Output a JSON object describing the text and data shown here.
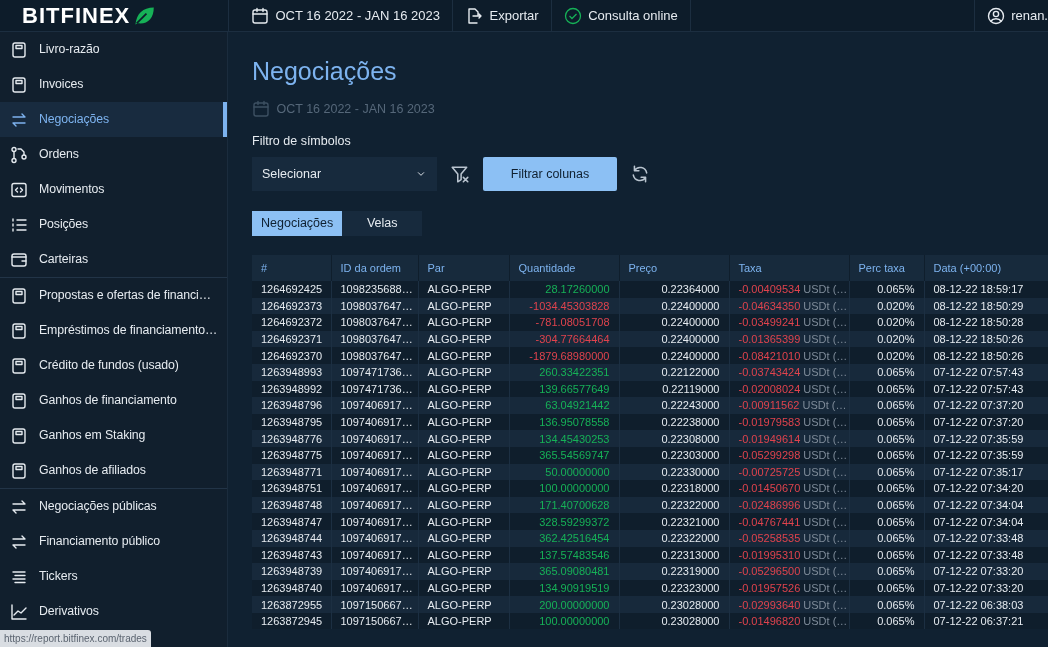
{
  "topbar": {
    "logo": "BITFINEX",
    "date_range": "OCT 16 2022 - JAN 16 2023",
    "export": "Exportar",
    "online": "Consulta online",
    "user": "renan."
  },
  "sidebar": {
    "groups": [
      {
        "items": [
          {
            "label": "Livro-razão",
            "kind": "book",
            "selected": false
          },
          {
            "label": "Invoices",
            "kind": "book",
            "selected": false
          },
          {
            "label": "Negociações",
            "kind": "swap",
            "selected": true
          },
          {
            "label": "Ordens",
            "kind": "branch",
            "selected": false
          },
          {
            "label": "Movimentos",
            "kind": "code",
            "selected": false
          },
          {
            "label": "Posições",
            "kind": "list",
            "selected": false
          },
          {
            "label": "Carteiras",
            "kind": "wallet",
            "selected": false
          }
        ]
      },
      {
        "items": [
          {
            "label": "Propostas e ofertas de financi…",
            "kind": "book",
            "selected": false
          },
          {
            "label": "Empréstimos de financiamento…",
            "kind": "book",
            "selected": false
          },
          {
            "label": "Crédito de fundos (usado)",
            "kind": "book",
            "selected": false
          },
          {
            "label": "Ganhos de financiamento",
            "kind": "book",
            "selected": false
          },
          {
            "label": "Ganhos em Staking",
            "kind": "book",
            "selected": false
          },
          {
            "label": "Ganhos de afiliados",
            "kind": "book",
            "selected": false
          }
        ]
      },
      {
        "items": [
          {
            "label": "Negociações públicas",
            "kind": "swap",
            "selected": false
          },
          {
            "label": "Financiamento público",
            "kind": "swap",
            "selected": false
          },
          {
            "label": "Tickers",
            "kind": "lines",
            "selected": false
          },
          {
            "label": "Derivativos",
            "kind": "chart",
            "selected": false
          }
        ]
      }
    ]
  },
  "status_url": "https://report.bitfinex.com/trades",
  "main": {
    "title": "Negociações",
    "date_range": "OCT 16 2022 - JAN 16 2023",
    "filter_label": "Filtro de símbolos",
    "select": {
      "value": "Selecionar"
    },
    "filter_button": "Filtrar colunas",
    "tabs": [
      {
        "label": "Negociações",
        "selected": true
      },
      {
        "label": "Velas",
        "selected": false
      }
    ],
    "table": {
      "columns": [
        "#",
        "ID da ordem",
        "Par",
        "Quantidade",
        "Preço",
        "Taxa",
        "Perc taxa",
        "Data (+00:00)"
      ],
      "rows": [
        {
          "id": "1264692425",
          "order": "1098235688…",
          "pair": "ALGO-PERP",
          "amount": "28.17260000",
          "kind": "buy",
          "price": "0.22364000",
          "fee": "-0.00409534",
          "fee_unit": "USDt (…",
          "fee_pct": "0.065%",
          "date": "08-12-22 18:59:17"
        },
        {
          "id": "1264692373",
          "order": "1098037647…",
          "pair": "ALGO-PERP",
          "amount": "-1034.45303828",
          "kind": "sell",
          "price": "0.22400000",
          "fee": "-0.04634350",
          "fee_unit": "USDt (…",
          "fee_pct": "0.020%",
          "date": "08-12-22 18:50:29"
        },
        {
          "id": "1264692372",
          "order": "1098037647…",
          "pair": "ALGO-PERP",
          "amount": "-781.08051708",
          "kind": "sell",
          "price": "0.22400000",
          "fee": "-0.03499241",
          "fee_unit": "USDt (…",
          "fee_pct": "0.020%",
          "date": "08-12-22 18:50:28"
        },
        {
          "id": "1264692371",
          "order": "1098037647…",
          "pair": "ALGO-PERP",
          "amount": "-304.77664464",
          "kind": "sell",
          "price": "0.22400000",
          "fee": "-0.01365399",
          "fee_unit": "USDt (…",
          "fee_pct": "0.020%",
          "date": "08-12-22 18:50:26"
        },
        {
          "id": "1264692370",
          "order": "1098037647…",
          "pair": "ALGO-PERP",
          "amount": "-1879.68980000",
          "kind": "sell",
          "price": "0.22400000",
          "fee": "-0.08421010",
          "fee_unit": "USDt (…",
          "fee_pct": "0.020%",
          "date": "08-12-22 18:50:26"
        },
        {
          "id": "1263948993",
          "order": "1097471736…",
          "pair": "ALGO-PERP",
          "amount": "260.33422351",
          "kind": "buy",
          "price": "0.22122000",
          "fee": "-0.03743424",
          "fee_unit": "USDt (…",
          "fee_pct": "0.065%",
          "date": "07-12-22 07:57:43"
        },
        {
          "id": "1263948992",
          "order": "1097471736…",
          "pair": "ALGO-PERP",
          "amount": "139.66577649",
          "kind": "buy",
          "price": "0.22119000",
          "fee": "-0.02008024",
          "fee_unit": "USDt (…",
          "fee_pct": "0.065%",
          "date": "07-12-22 07:57:43"
        },
        {
          "id": "1263948796",
          "order": "1097406917…",
          "pair": "ALGO-PERP",
          "amount": "63.04921442",
          "kind": "buy",
          "price": "0.22243000",
          "fee": "-0.00911562",
          "fee_unit": "USDt (…",
          "fee_pct": "0.065%",
          "date": "07-12-22 07:37:20"
        },
        {
          "id": "1263948795",
          "order": "1097406917…",
          "pair": "ALGO-PERP",
          "amount": "136.95078558",
          "kind": "buy",
          "price": "0.22238000",
          "fee": "-0.01979583",
          "fee_unit": "USDt (…",
          "fee_pct": "0.065%",
          "date": "07-12-22 07:37:20"
        },
        {
          "id": "1263948776",
          "order": "1097406917…",
          "pair": "ALGO-PERP",
          "amount": "134.45430253",
          "kind": "buy",
          "price": "0.22308000",
          "fee": "-0.01949614",
          "fee_unit": "USDt (…",
          "fee_pct": "0.065%",
          "date": "07-12-22 07:35:59"
        },
        {
          "id": "1263948775",
          "order": "1097406917…",
          "pair": "ALGO-PERP",
          "amount": "365.54569747",
          "kind": "buy",
          "price": "0.22303000",
          "fee": "-0.05299298",
          "fee_unit": "USDt (…",
          "fee_pct": "0.065%",
          "date": "07-12-22 07:35:59"
        },
        {
          "id": "1263948771",
          "order": "1097406917…",
          "pair": "ALGO-PERP",
          "amount": "50.00000000",
          "kind": "buy",
          "price": "0.22330000",
          "fee": "-0.00725725",
          "fee_unit": "USDt (…",
          "fee_pct": "0.065%",
          "date": "07-12-22 07:35:17"
        },
        {
          "id": "1263948751",
          "order": "1097406917…",
          "pair": "ALGO-PERP",
          "amount": "100.00000000",
          "kind": "buy",
          "price": "0.22318000",
          "fee": "-0.01450670",
          "fee_unit": "USDt (…",
          "fee_pct": "0.065%",
          "date": "07-12-22 07:34:20"
        },
        {
          "id": "1263948748",
          "order": "1097406917…",
          "pair": "ALGO-PERP",
          "amount": "171.40700628",
          "kind": "buy",
          "price": "0.22322000",
          "fee": "-0.02486996",
          "fee_unit": "USDt (…",
          "fee_pct": "0.065%",
          "date": "07-12-22 07:34:04"
        },
        {
          "id": "1263948747",
          "order": "1097406917…",
          "pair": "ALGO-PERP",
          "amount": "328.59299372",
          "kind": "buy",
          "price": "0.22321000",
          "fee": "-0.04767441",
          "fee_unit": "USDt (…",
          "fee_pct": "0.065%",
          "date": "07-12-22 07:34:04"
        },
        {
          "id": "1263948744",
          "order": "1097406917…",
          "pair": "ALGO-PERP",
          "amount": "362.42516454",
          "kind": "buy",
          "price": "0.22322000",
          "fee": "-0.05258535",
          "fee_unit": "USDt (…",
          "fee_pct": "0.065%",
          "date": "07-12-22 07:33:48"
        },
        {
          "id": "1263948743",
          "order": "1097406917…",
          "pair": "ALGO-PERP",
          "amount": "137.57483546",
          "kind": "buy",
          "price": "0.22313000",
          "fee": "-0.01995310",
          "fee_unit": "USDt (…",
          "fee_pct": "0.065%",
          "date": "07-12-22 07:33:48"
        },
        {
          "id": "1263948739",
          "order": "1097406917…",
          "pair": "ALGO-PERP",
          "amount": "365.09080481",
          "kind": "buy",
          "price": "0.22319000",
          "fee": "-0.05296500",
          "fee_unit": "USDt (…",
          "fee_pct": "0.065%",
          "date": "07-12-22 07:33:20"
        },
        {
          "id": "1263948740",
          "order": "1097406917…",
          "pair": "ALGO-PERP",
          "amount": "134.90919519",
          "kind": "buy",
          "price": "0.22323000",
          "fee": "-0.01957526",
          "fee_unit": "USDt (…",
          "fee_pct": "0.065%",
          "date": "07-12-22 07:33:20"
        },
        {
          "id": "1263872955",
          "order": "1097150667…",
          "pair": "ALGO-PERP",
          "amount": "200.00000000",
          "kind": "buy",
          "price": "0.23028000",
          "fee": "-0.02993640",
          "fee_unit": "USDt (…",
          "fee_pct": "0.065%",
          "date": "07-12-22 06:38:03"
        },
        {
          "id": "1263872945",
          "order": "1097150667…",
          "pair": "ALGO-PERP",
          "amount": "100.00000000",
          "kind": "buy",
          "price": "0.23028000",
          "fee": "-0.01496820",
          "fee_unit": "USDt (…",
          "fee_pct": "0.065%",
          "date": "07-12-22 06:37:21"
        }
      ]
    }
  }
}
